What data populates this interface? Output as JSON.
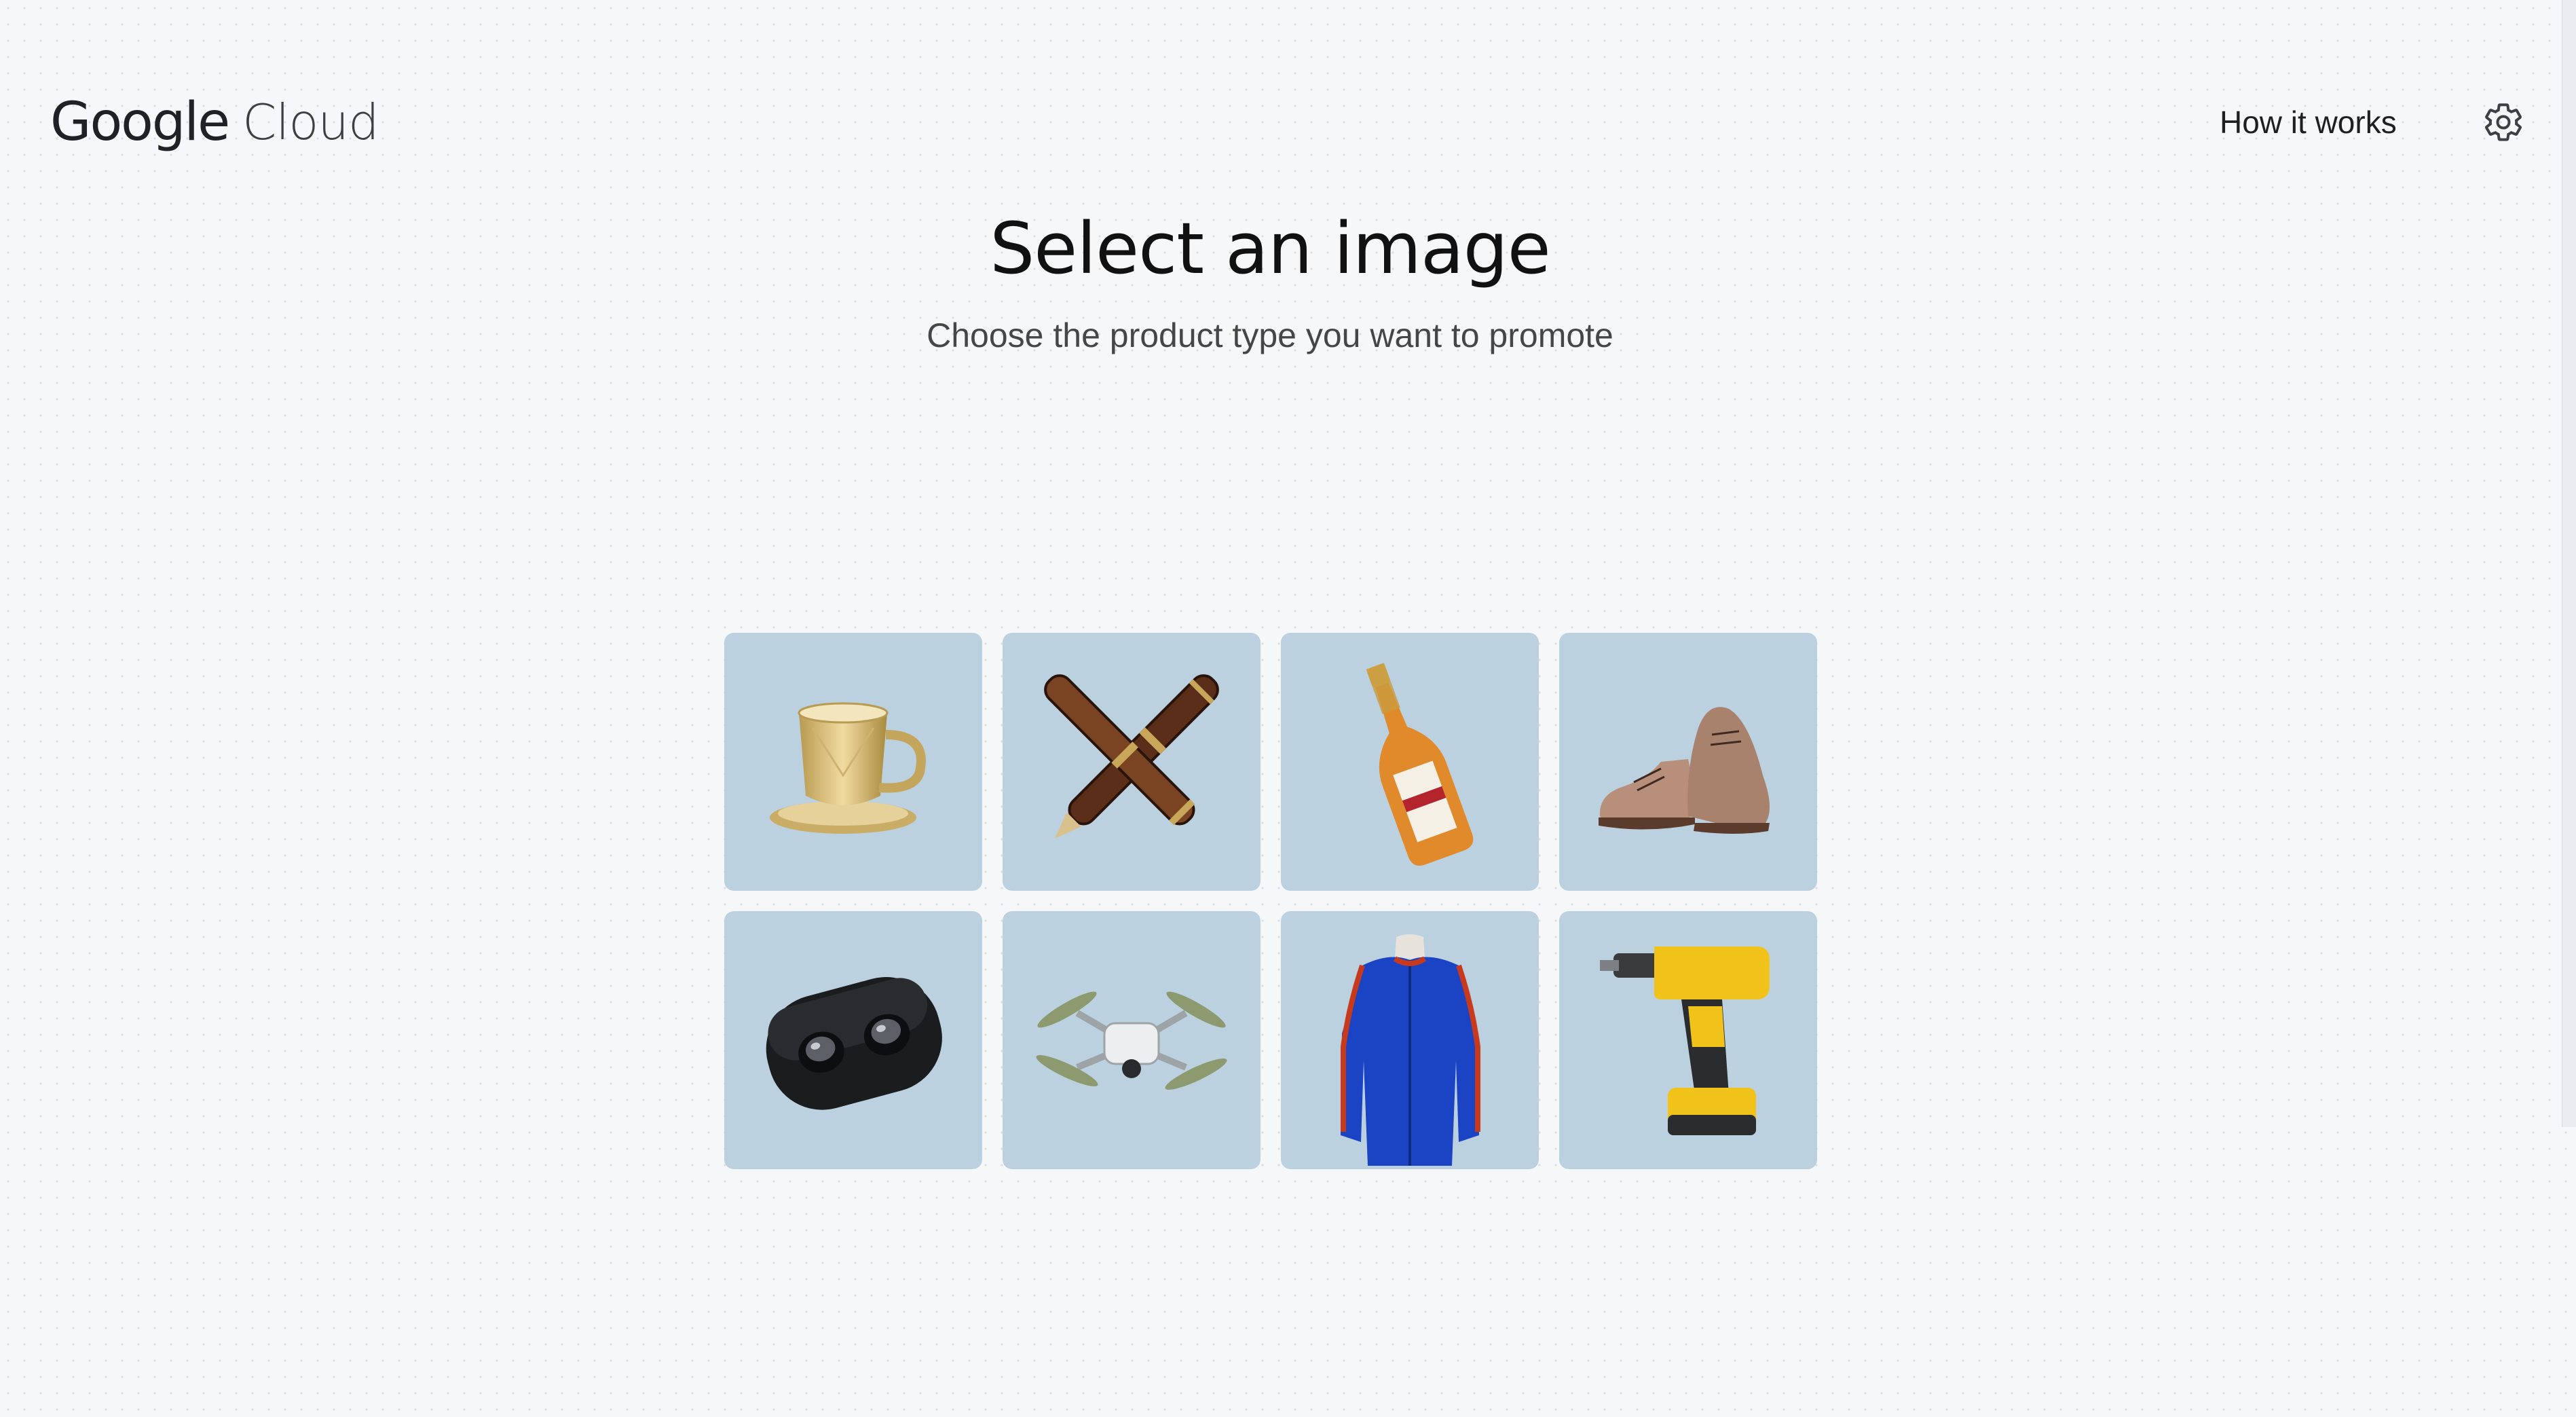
{
  "header": {
    "logo_google": "Google",
    "logo_cloud": "Cloud",
    "how_it_works": "How it works"
  },
  "main": {
    "title": "Select an image",
    "subtitle": "Choose the product type you want to promote"
  },
  "products": [
    {
      "icon": "teacup-icon"
    },
    {
      "icon": "fountain-pens-icon"
    },
    {
      "icon": "champagne-bottle-icon"
    },
    {
      "icon": "leather-shoes-icon"
    },
    {
      "icon": "earbuds-case-icon"
    },
    {
      "icon": "drone-icon"
    },
    {
      "icon": "sport-jacket-icon"
    },
    {
      "icon": "power-drill-icon"
    }
  ],
  "colors": {
    "tile_background": "#bcd1df",
    "page_background": "#f6f7f9"
  }
}
